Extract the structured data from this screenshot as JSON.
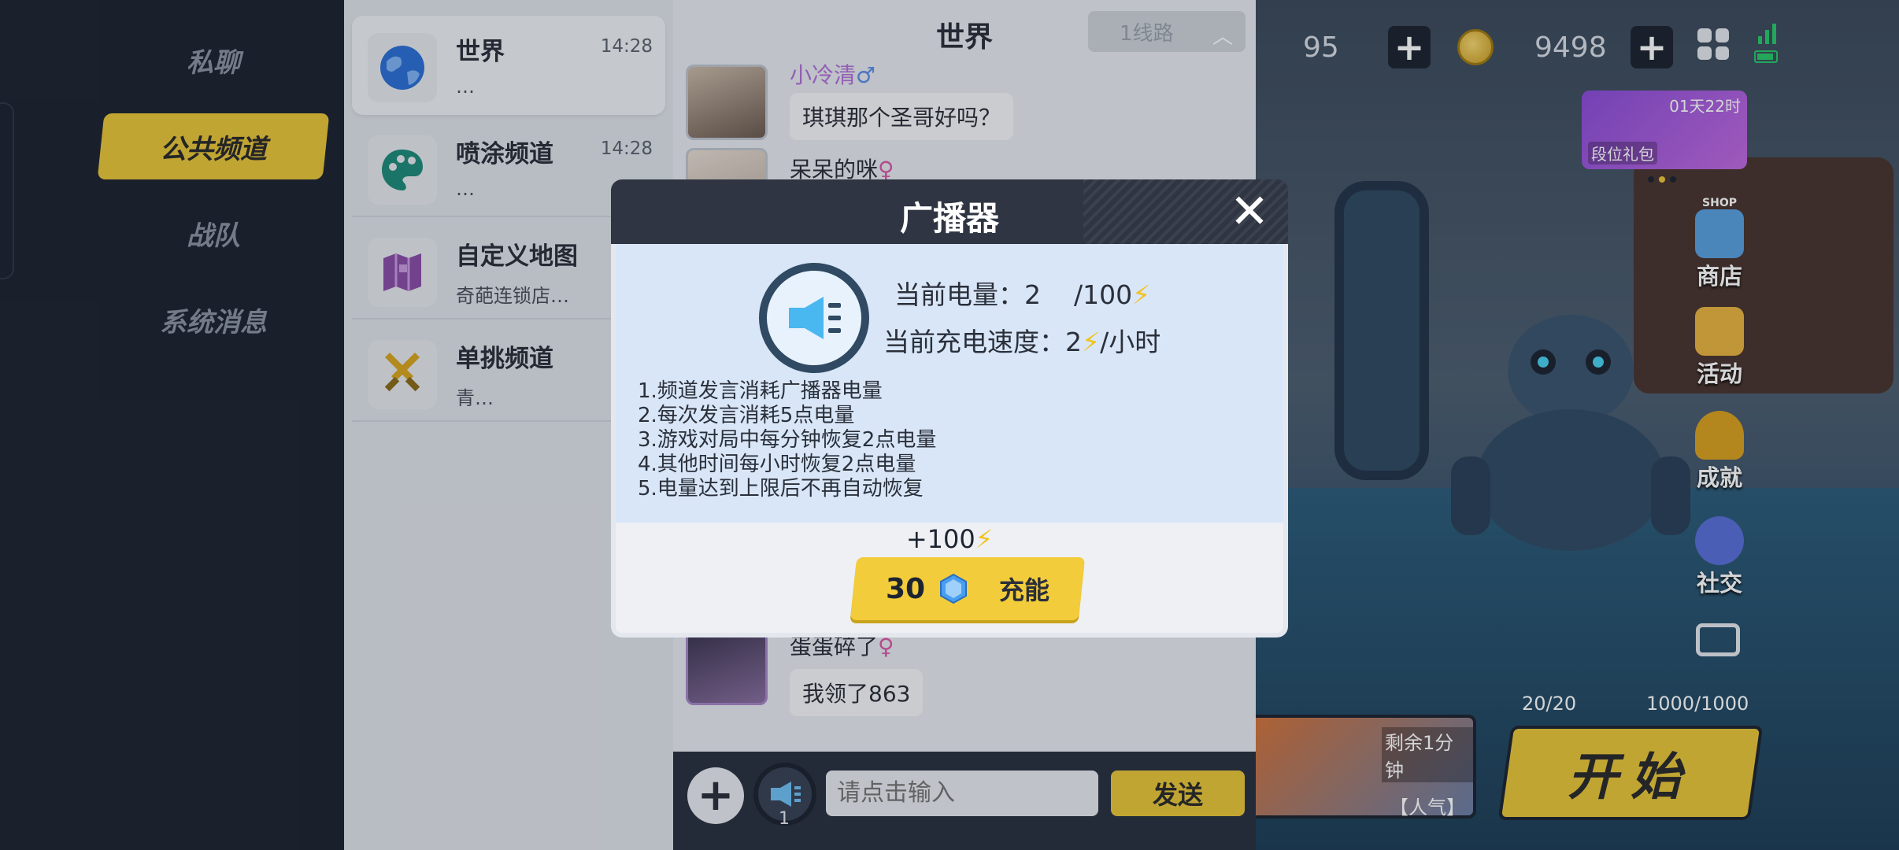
{
  "nav": {
    "items": [
      {
        "label": "私聊"
      },
      {
        "label": "公共频道"
      },
      {
        "label": "战队"
      },
      {
        "label": "系统消息"
      }
    ]
  },
  "channels": [
    {
      "name": "世界",
      "time": "14:28",
      "preview": "…"
    },
    {
      "name": "喷涂频道",
      "time": "14:28",
      "preview": "…"
    },
    {
      "name": "自定义地图",
      "time": "1",
      "preview": "奇葩连锁店…"
    },
    {
      "name": "单挑频道",
      "time": "1",
      "preview": "青…"
    }
  ],
  "chat": {
    "title": "世界",
    "line_select": "1线路",
    "messages": [
      {
        "name": "小冷清",
        "gender": "♂",
        "text": "琪琪那个圣哥好吗？"
      },
      {
        "name": "呆呆的咪",
        "gender": "♀",
        "text": ""
      },
      {
        "name": "蛋蛋碎了",
        "gender": "♀",
        "text": "我领了863"
      }
    ],
    "horn_count": "1",
    "input_placeholder": "请点击输入",
    "send_label": "发送"
  },
  "game": {
    "stat_left": "95",
    "coins": "9498",
    "gift_timer": "01天22时",
    "gift_label": "段位礼包",
    "shop_tag": "SHOP",
    "side_buttons": [
      {
        "label": "商店"
      },
      {
        "label": "活动"
      },
      {
        "label": "成就"
      },
      {
        "label": "社交"
      }
    ],
    "resource_1": "20/20",
    "resource_2": "1000/1000",
    "mode_remain": "剩余1分钟",
    "mode_tag": "【人气】",
    "start_label": "开始"
  },
  "modal": {
    "title": "广播器",
    "close_icon": "close-icon",
    "power_label": "当前电量：2",
    "power_max": "/100",
    "speed_label": "当前充电速度：2",
    "speed_unit": "/小时",
    "rules": [
      "1.频道发言消耗广播器电量",
      "2.每次发言消耗5点电量",
      "3.游戏对局中每分钟恢复2点电量",
      "4.其他时间每小时恢复2点电量",
      "5.电量达到上限后不再自动恢复"
    ],
    "charge_amount": "+100",
    "charge_cost": "30",
    "charge_label": "充能",
    "bolt": "⚡"
  },
  "colors": {
    "accent": "#e9c63a",
    "dark": "#1d2431",
    "panel_blue": "#d8e6f7"
  }
}
